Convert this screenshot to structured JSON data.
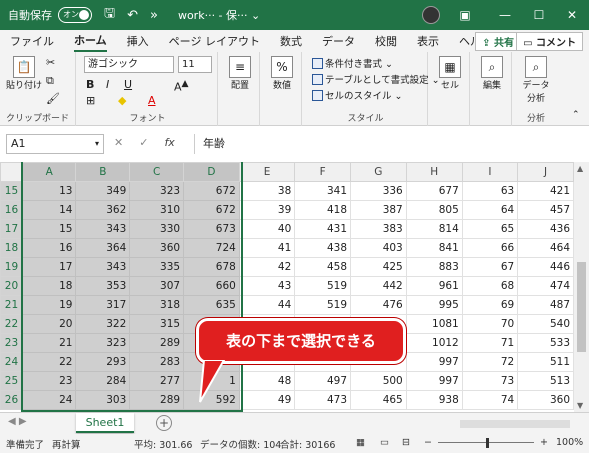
{
  "titlebar": {
    "autosave_label": "自動保存",
    "toggle_label": "オン",
    "title": "work··· - 保··· ⌄",
    "minimize": "—",
    "maximize": "☐",
    "close": "✕"
  },
  "tabs": [
    "ファイル",
    "ホーム",
    "挿入",
    "ページ レイアウト",
    "数式",
    "データ",
    "校閲",
    "表示",
    "ヘルプ"
  ],
  "active_tab": "ホーム",
  "share_label": "共有",
  "comment_label": "コメント",
  "ribbon": {
    "clipboard": {
      "paste": "貼り付け",
      "label": "クリップボード"
    },
    "font": {
      "name": "游ゴシック",
      "size": "11",
      "label": "フォント",
      "bold": "B",
      "italic": "I",
      "underline": "U"
    },
    "alignment": {
      "label": "配置"
    },
    "number": {
      "label": "数値"
    },
    "styles": {
      "conditional": "条件付き書式",
      "table": "テーブルとして書式設定",
      "cell_style": "セルのスタイル",
      "label": "スタイル"
    },
    "cells": {
      "label": "セル"
    },
    "edit": {
      "label": "編集"
    },
    "analysis": {
      "button": "データ分析",
      "label": "分析"
    }
  },
  "formula_bar": {
    "name_box": "A1",
    "fx": "fx",
    "content": "年齢"
  },
  "columns": [
    "A",
    "B",
    "C",
    "D",
    "E",
    "F",
    "G",
    "H",
    "I",
    "J"
  ],
  "rows": [
    {
      "n": "15",
      "cells": [
        "13",
        "349",
        "323",
        "672",
        "38",
        "341",
        "336",
        "677",
        "63",
        "421"
      ]
    },
    {
      "n": "16",
      "cells": [
        "14",
        "362",
        "310",
        "672",
        "39",
        "418",
        "387",
        "805",
        "64",
        "457"
      ]
    },
    {
      "n": "17",
      "cells": [
        "15",
        "343",
        "330",
        "673",
        "40",
        "431",
        "383",
        "814",
        "65",
        "436"
      ]
    },
    {
      "n": "18",
      "cells": [
        "16",
        "364",
        "360",
        "724",
        "41",
        "438",
        "403",
        "841",
        "66",
        "464"
      ]
    },
    {
      "n": "19",
      "cells": [
        "17",
        "343",
        "335",
        "678",
        "42",
        "458",
        "425",
        "883",
        "67",
        "446"
      ]
    },
    {
      "n": "20",
      "cells": [
        "18",
        "353",
        "307",
        "660",
        "43",
        "519",
        "442",
        "961",
        "68",
        "474"
      ]
    },
    {
      "n": "21",
      "cells": [
        "19",
        "317",
        "318",
        "635",
        "44",
        "519",
        "476",
        "995",
        "69",
        "487"
      ]
    },
    {
      "n": "22",
      "cells": [
        "20",
        "322",
        "315",
        "",
        "",
        "",
        "",
        "1081",
        "70",
        "540"
      ]
    },
    {
      "n": "23",
      "cells": [
        "21",
        "323",
        "289",
        "",
        "",
        "",
        "5",
        "1012",
        "71",
        "533"
      ]
    },
    {
      "n": "24",
      "cells": [
        "22",
        "293",
        "283",
        "",
        "",
        "",
        "",
        "997",
        "72",
        "511"
      ]
    },
    {
      "n": "25",
      "cells": [
        "23",
        "284",
        "277",
        "1",
        "48",
        "497",
        "500",
        "997",
        "73",
        "513"
      ]
    },
    {
      "n": "26",
      "cells": [
        "24",
        "303",
        "289",
        "592",
        "49",
        "473",
        "465",
        "938",
        "74",
        "360"
      ]
    }
  ],
  "callout_text": "表の下まで選択できる",
  "sheet_tab": "Sheet1",
  "add_sheet": "+",
  "status": {
    "ready": "準備完了",
    "recalc": "再計算",
    "average": "平均: 301.66",
    "count": "データの個数: 104",
    "sum": "合計: 30166",
    "zoom": "100%"
  }
}
